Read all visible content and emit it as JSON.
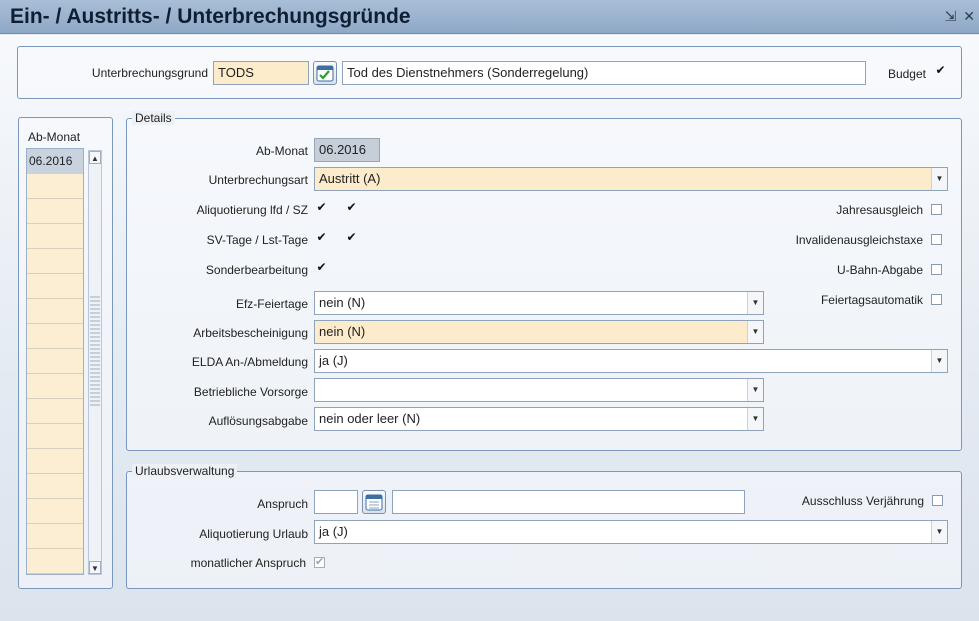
{
  "window": {
    "title": "Ein- / Austritts- / Unterbrechungsgründe",
    "minimize_glyph": "⇲",
    "close_glyph": "✕"
  },
  "header": {
    "reason_label": "Unterbrechungsgrund",
    "reason_code": "TODS",
    "reason_text": "Tod des Dienstnehmers (Sonderregelung)",
    "budget_label": "Budget",
    "budget_checked": true
  },
  "ab_monat_list": {
    "header": "Ab-Monat",
    "items": [
      "06.2016"
    ]
  },
  "details": {
    "legend": "Details",
    "ab_monat_label": "Ab-Monat",
    "ab_monat_value": "06.2016",
    "unterbrechungsart_label": "Unterbrechungsart",
    "unterbrechungsart_value": "Austritt (A)",
    "aliquotierung_label": "Aliquotierung lfd / SZ",
    "svtage_label": "SV-Tage / Lst-Tage",
    "sonderbearbeitung_label": "Sonderbearbeitung",
    "efz_label": "Efz-Feiertage",
    "efz_value": "nein (N)",
    "arbeitsbescheinigung_label": "Arbeitsbescheinigung",
    "arbeitsbescheinigung_value": "nein (N)",
    "elda_label": "ELDA An-/Abmeldung",
    "elda_value": "ja (J)",
    "vorsorge_label": "Betriebliche Vorsorge",
    "vorsorge_value": "",
    "aufloesung_label": "Auflösungsabgabe",
    "aufloesung_value": "nein oder leer (N)",
    "jahresausgleich_label": "Jahresausgleich",
    "invaliden_label": "Invalidenausgleichstaxe",
    "ubahn_label": "U-Bahn-Abgabe",
    "feiertag_label": "Feiertagsautomatik"
  },
  "urlaub": {
    "legend": "Urlaubsverwaltung",
    "anspruch_label": "Anspruch",
    "anspruch_value": "",
    "anspruch_text": "",
    "ausschluss_label": "Ausschluss Verjährung",
    "aliquot_label": "Aliquotierung Urlaub",
    "aliquot_value": "ja (J)",
    "monatlich_label": "monatlicher Anspruch"
  },
  "icons": {
    "check_glyph": "✔",
    "dropdown_glyph": "▼",
    "up_glyph": "▲",
    "down_glyph": "▼"
  }
}
